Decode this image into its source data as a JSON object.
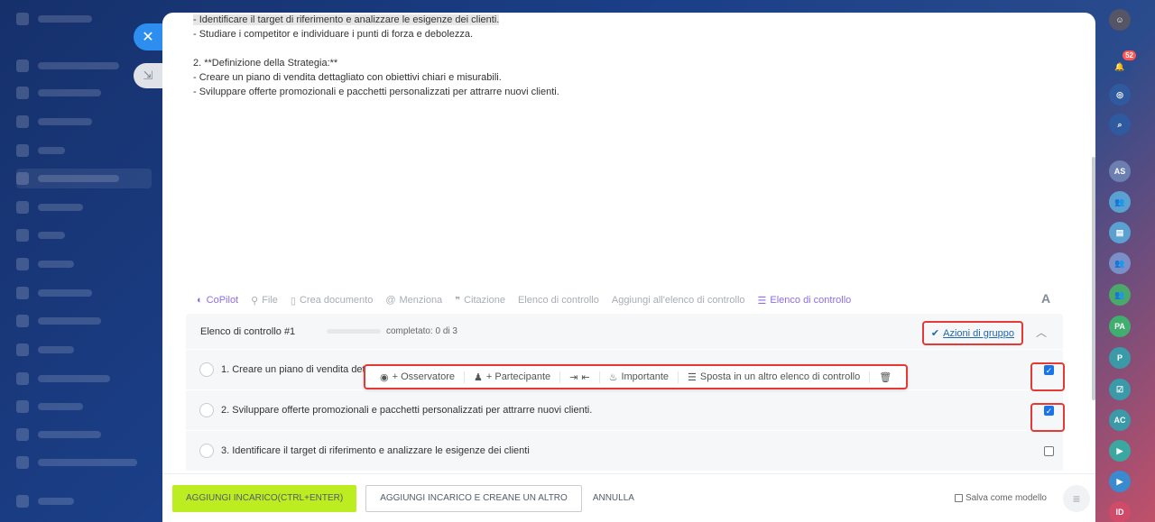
{
  "editor": {
    "lines": [
      "- Identificare il target di riferimento e analizzare le esigenze dei clienti.",
      "- Studiare i competitor e individuare i punti di forza e debolezza.",
      "",
      "2. **Definizione della Strategia:**",
      "- Creare un piano di vendita dettagliato con obiettivi chiari e misurabili.",
      "- Sviluppare offerte promozionali e pacchetti personalizzati per attrarre nuovi clienti."
    ]
  },
  "toolbar": {
    "copilot": "CoPilot",
    "file": "File",
    "create_doc": "Crea documento",
    "mention": "Menziona",
    "quote": "Citazione",
    "checklist": "Elenco di controllo",
    "add_to_checklist": "Aggiungi all'elenco di controllo",
    "checklist_active": "Elenco di controllo",
    "font": "A"
  },
  "checklist": {
    "title": "Elenco di controllo #1",
    "progress_text": "completato: 0 di 3",
    "progress_fraction": 0,
    "group_actions": "Azioni di gruppo",
    "items": [
      {
        "label": "1. Creare un piano di vendita detta",
        "checked": true
      },
      {
        "label": "2. Sviluppare offerte promozionali e pacchetti personalizzati per attrarre nuovi clienti.",
        "checked": true
      },
      {
        "label": "3. Identificare il target di riferimento e analizzare le esigenze dei clienti",
        "checked": false
      }
    ],
    "item_toolbar": {
      "observer": "+ Osservatore",
      "participant": "+ Partecipante",
      "important": "Importante",
      "move": "Sposta in un altro elenco di controllo"
    }
  },
  "footer": {
    "add_task": "AGGIUNGI INCARICO(CTRL+ENTER)",
    "add_and_create": "AGGIUNGI INCARICO E CREANE UN ALTRO",
    "cancel": "ANNULLA",
    "save_template": "Salva come modello"
  },
  "rail": {
    "notifications_count": "52",
    "avatars": [
      "AS",
      "PA",
      "P",
      "AC",
      "ID"
    ]
  },
  "colors": {
    "accent_blue": "#2d8ef0",
    "primary_green": "#bbed21",
    "highlight_red": "#e53935",
    "copilot_purple": "#8f6ee4"
  }
}
